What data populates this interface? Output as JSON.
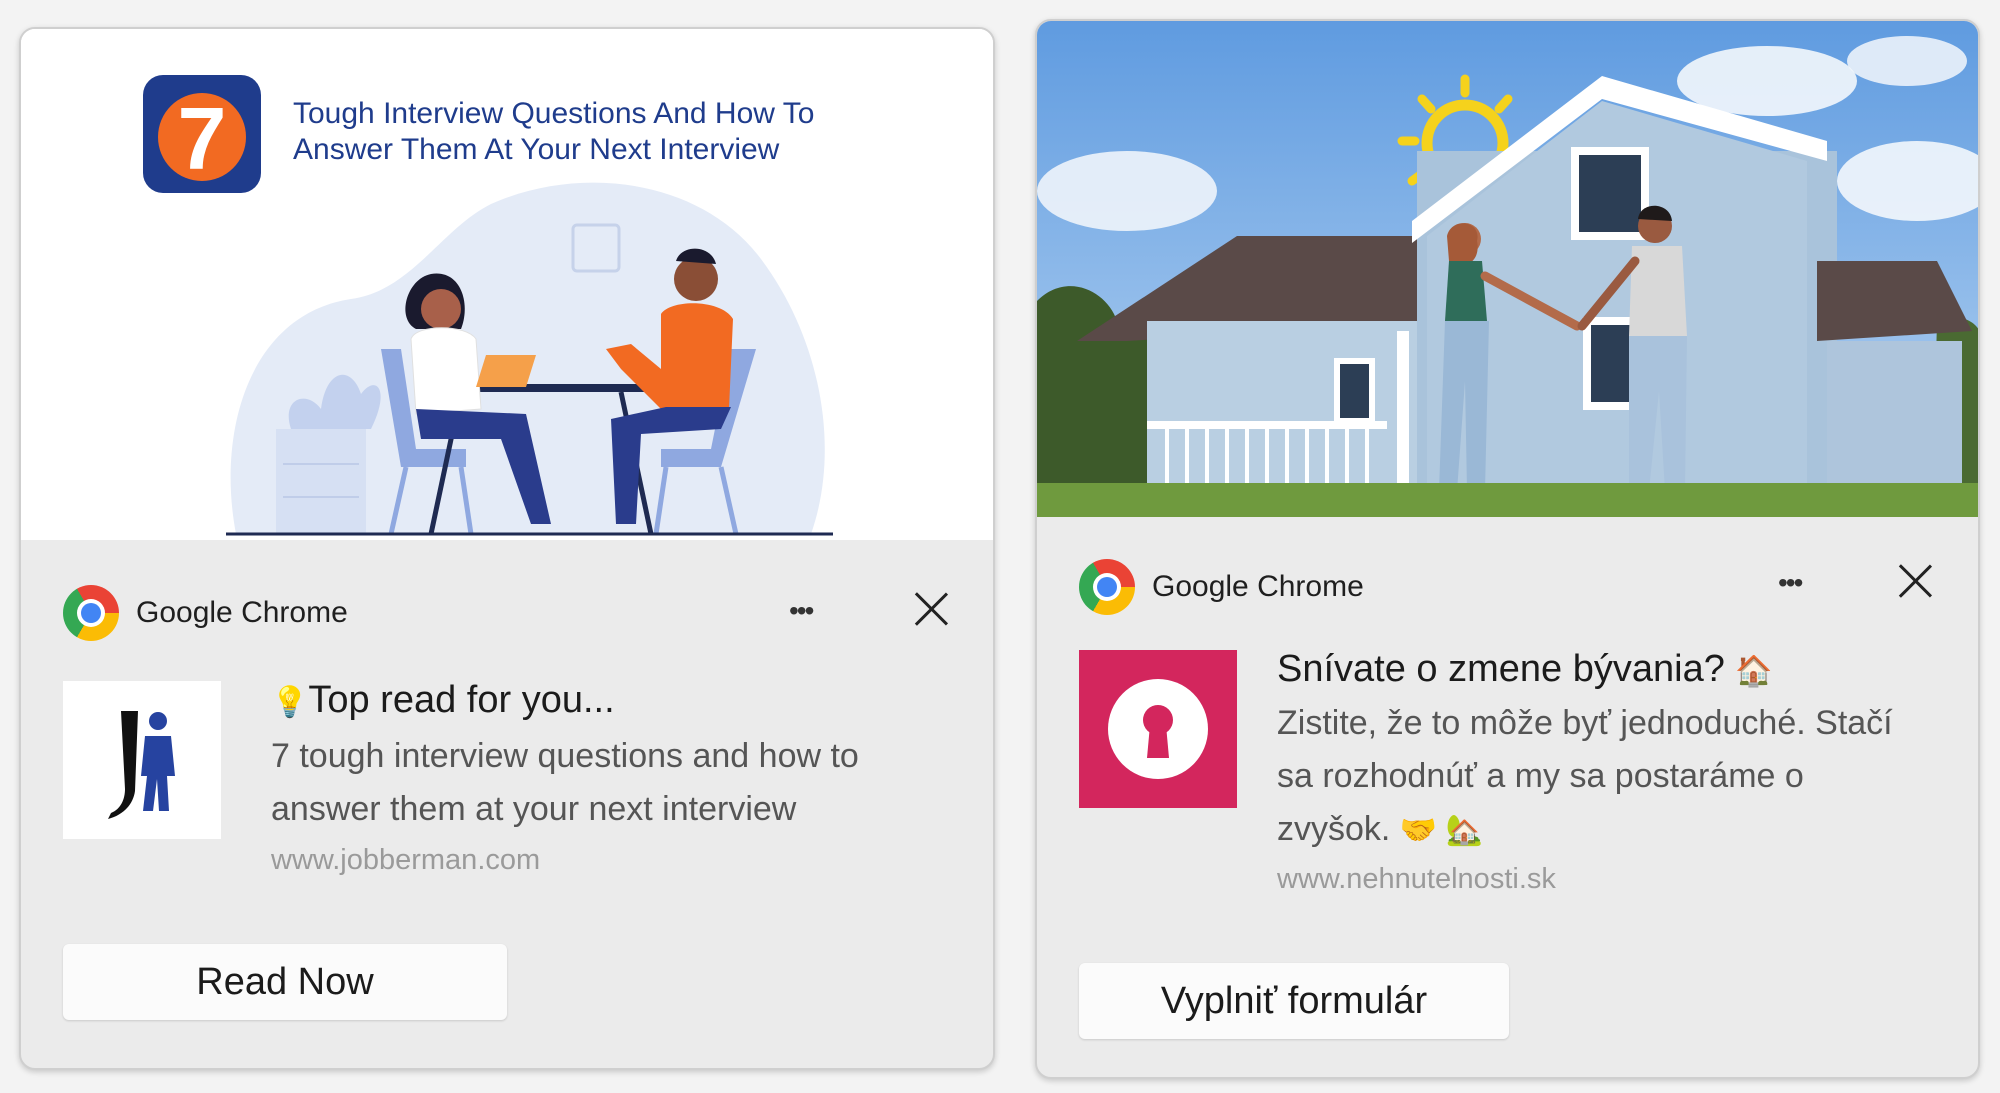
{
  "notifications": [
    {
      "hero_headline_line1": "Tough Interview Questions And How To",
      "hero_headline_line2": "Answer Them At Your Next Interview",
      "hero_badge": "7",
      "app_name": "Google Chrome",
      "more_label": "•••",
      "title": "Top read for you...",
      "title_emoji": "💡",
      "message_line1": "7 tough interview questions and how to",
      "message_line2": "answer them at your next interview",
      "source": "www.jobberman.com",
      "button_label": "Read Now"
    },
    {
      "app_name": "Google Chrome",
      "more_label": "•••",
      "title": "Snívate o zmene bývania?",
      "title_emoji": "🏠",
      "message_line1": "Zistite, že to môže byť jednoduché. Stačí",
      "message_line2": "sa rozhodnúť a my sa postaráme o",
      "message_line3": "zvyšok.",
      "message_emoji": "🤝 🏡",
      "source": "www.nehnutelnosti.sk",
      "button_label": "Vyplniť formulár"
    }
  ],
  "colors": {
    "headline_blue": "#1f3c8c",
    "badge_orange": "#f26a22",
    "lock_pink": "#d3265d"
  }
}
